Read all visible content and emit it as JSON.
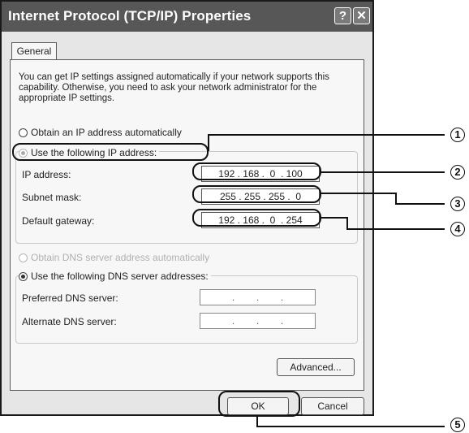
{
  "window": {
    "title": "Internet Protocol (TCP/IP) Properties",
    "help_button": "?",
    "close_button": "✕"
  },
  "tabs": [
    {
      "label": "General"
    }
  ],
  "description": "You can get IP settings assigned automatically if your network supports this capability. Otherwise, you need to ask your network administrator for the appropriate IP settings.",
  "ip_section": {
    "obtain_auto": "Obtain an IP address automatically",
    "use_following": "Use the following IP address:",
    "fields": [
      {
        "label": "IP address:",
        "value": "192 . 168 .  0  . 100"
      },
      {
        "label": "Subnet mask:",
        "value": "255 . 255 . 255 .  0"
      },
      {
        "label": "Default gateway:",
        "value": "192 . 168 .  0  . 254"
      }
    ]
  },
  "dns_section": {
    "obtain_auto": "Obtain DNS server address automatically",
    "use_following": "Use the following DNS server addresses:",
    "fields": [
      {
        "label": "Preferred DNS server:",
        "value": ".        .        ."
      },
      {
        "label": "Alternate DNS server:",
        "value": ".        .        ."
      }
    ]
  },
  "buttons": {
    "advanced": "Advanced...",
    "ok": "OK",
    "cancel": "Cancel"
  },
  "callout_numbers": [
    "1",
    "2",
    "3",
    "4",
    "5"
  ]
}
